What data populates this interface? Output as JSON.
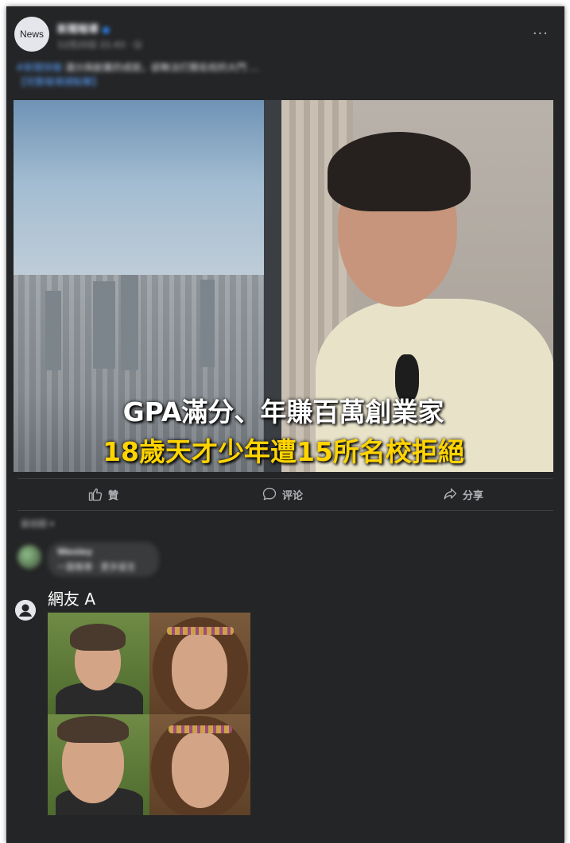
{
  "post": {
    "avatar_label": "News",
    "page_name": "新聞報導",
    "verified_mark": "●",
    "meta": "12月20日 21:43 · ☺",
    "caption_tag": "#新聞快報",
    "caption_text": "滿分與創業的成就，卻無法打開名校的大門 …",
    "caption_link": "【完整報導請點擊】"
  },
  "photo": {
    "overlay_line1": "GPA滿分、年賺百萬創業家",
    "overlay_line2": "18歲天才少年遭15所名校拒絕"
  },
  "actions": {
    "like": "贊",
    "comment": "评论",
    "share": "分享"
  },
  "comments": {
    "sort_label": "最相關 ▾",
    "first": {
      "author": "Wesley",
      "text": "一篇報導 · 更多留言"
    },
    "reply": {
      "author": "網友 A"
    }
  },
  "colors": {
    "card_bg": "#242526",
    "text_primary": "#e4e6eb",
    "text_secondary": "#b0b3b8",
    "overlay_highlight": "#ffd400",
    "link": "#5aa0ff"
  }
}
